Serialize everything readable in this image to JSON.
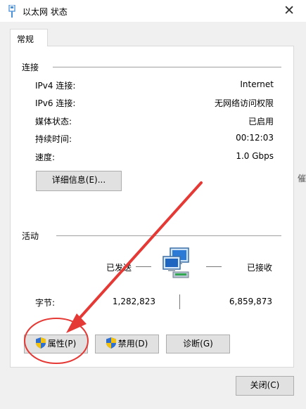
{
  "window": {
    "title": "以太网 状态",
    "close_glyph": "✕"
  },
  "tab": {
    "label": "常规"
  },
  "connection": {
    "section_label": "连接",
    "rows": [
      {
        "label": "IPv4 连接:",
        "value": "Internet"
      },
      {
        "label": "IPv6 连接:",
        "value": "无网络访问权限"
      },
      {
        "label": "媒体状态:",
        "value": "已启用"
      },
      {
        "label": "持续时间:",
        "value": "00:12:03"
      },
      {
        "label": "速度:",
        "value": "1.0 Gbps"
      }
    ],
    "details_button": "详细信息(E)..."
  },
  "activity": {
    "section_label": "活动",
    "sent_label": "已发送",
    "received_label": "已接收",
    "bytes_label": "字节:",
    "bytes_sent": "1,282,823",
    "bytes_received": "6,859,873",
    "icon": "network-computers-icon"
  },
  "buttons": {
    "properties": "属性(P)",
    "disable": "禁用(D)",
    "diagnose": "诊断(G)",
    "close": "关闭(C)"
  },
  "side_text": "催",
  "annotation": {
    "color": "#e53935"
  },
  "colors": {
    "shield_blue": "#2e6fd0",
    "shield_yellow": "#f4c20d"
  }
}
